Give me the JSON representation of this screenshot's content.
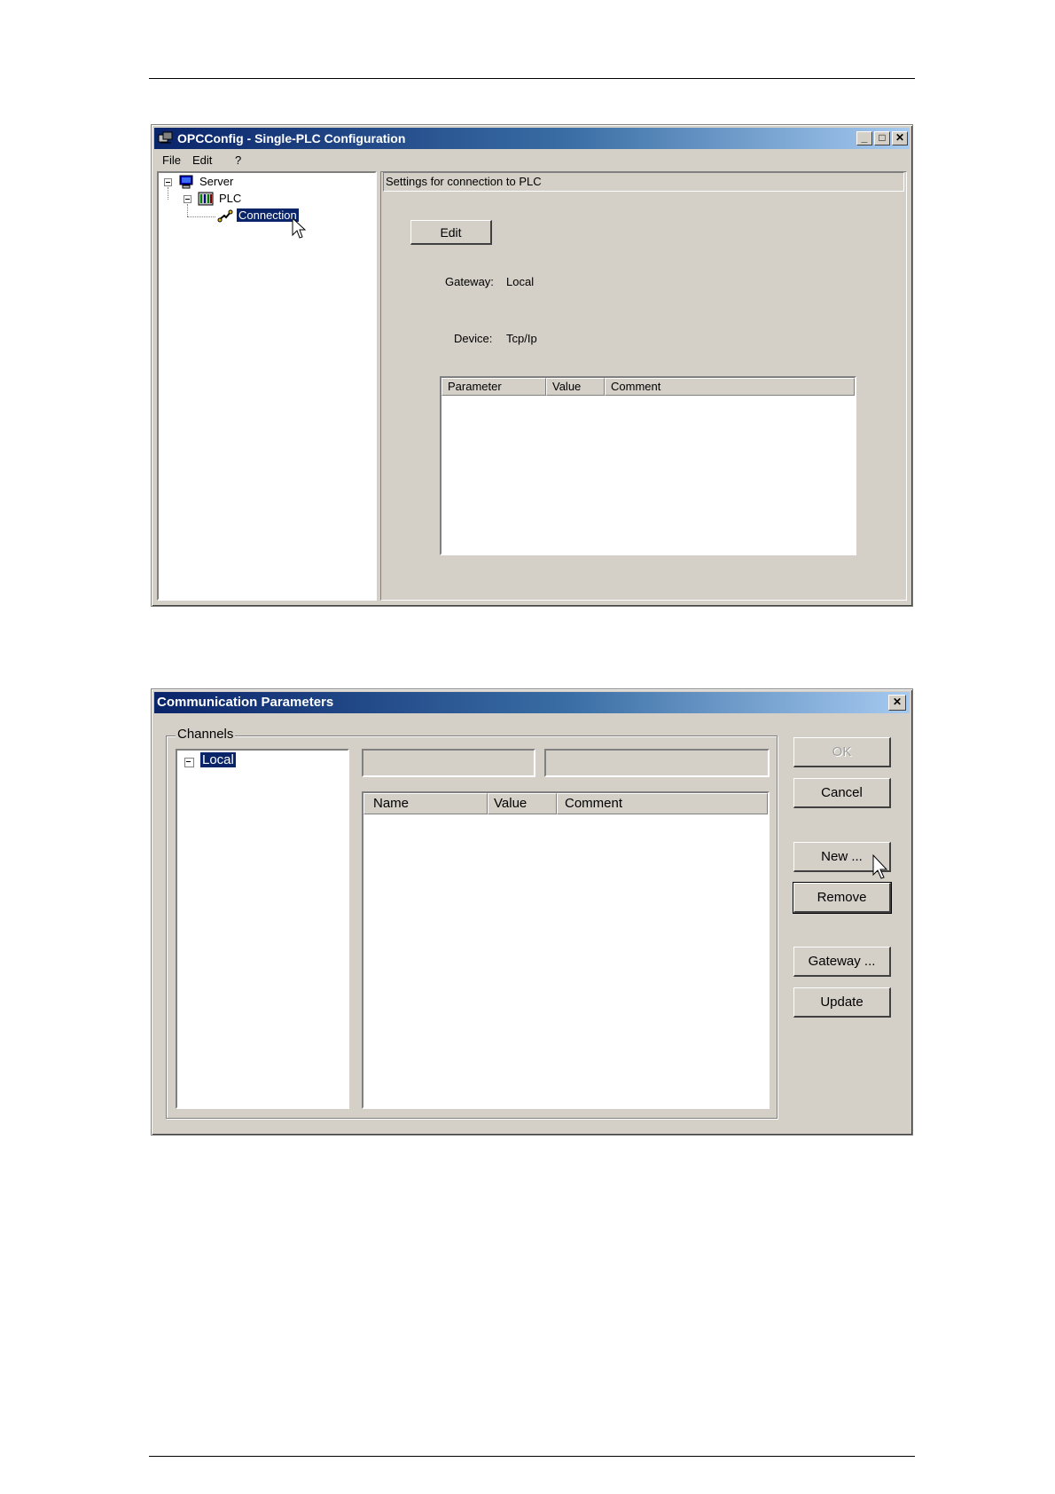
{
  "window1": {
    "title": "OPCConfig - Single-PLC Configuration",
    "menu": [
      "File",
      "Edit",
      "?"
    ],
    "tree": {
      "server": "Server",
      "plc": "PLC",
      "connection": "Connection"
    },
    "panel_header": "Settings for connection to PLC",
    "edit_button": "Edit",
    "gateway_label": "Gateway:",
    "gateway_value": "Local",
    "device_label": "Device:",
    "device_value": "Tcp/Ip",
    "table_columns": [
      "Parameter",
      "Value",
      "Comment"
    ]
  },
  "window2": {
    "title": "Communication Parameters",
    "channels_label": "Channels",
    "tree_local": "Local",
    "table_columns": [
      "Name",
      "Value",
      "Comment"
    ],
    "buttons": {
      "ok": "OK",
      "cancel": "Cancel",
      "new": "New ...",
      "remove": "Remove",
      "gateway": "Gateway ...",
      "update": "Update"
    }
  },
  "colors": {
    "title_start": "#0a246a",
    "title_end": "#a6caf0",
    "face": "#d4d0c8",
    "selection": "#0a246a"
  }
}
